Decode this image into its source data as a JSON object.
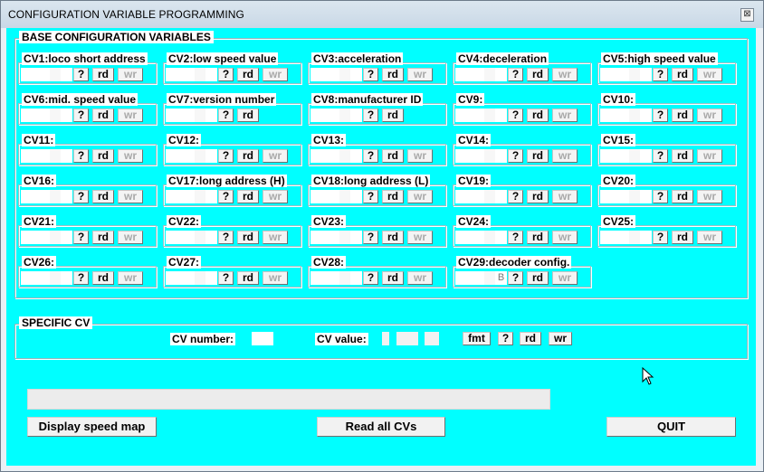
{
  "window": {
    "title": "CONFIGURATION VARIABLE PROGRAMMING",
    "close_glyph": "⊠"
  },
  "base": {
    "label": "BASE CONFIGURATION VARIABLES",
    "cvs": [
      {
        "label": "CV1:loco short address",
        "q": "?",
        "rd": "rd",
        "wr": "wr"
      },
      {
        "label": "CV2:low speed value",
        "q": "?",
        "rd": "rd",
        "wr": "wr"
      },
      {
        "label": "CV3:acceleration",
        "q": "?",
        "rd": "rd",
        "wr": "wr"
      },
      {
        "label": "CV4:deceleration",
        "q": "?",
        "rd": "rd",
        "wr": "wr"
      },
      {
        "label": "CV5:high speed value",
        "q": "?",
        "rd": "rd",
        "wr": "wr"
      },
      {
        "label": "CV6:mid. speed value",
        "q": "?",
        "rd": "rd",
        "wr": "wr"
      },
      {
        "label": "CV7:version number",
        "q": "?",
        "rd": "rd",
        "wr": ""
      },
      {
        "label": "CV8:manufacturer ID",
        "q": "?",
        "rd": "rd",
        "wr": ""
      },
      {
        "label": "CV9:",
        "q": "?",
        "rd": "rd",
        "wr": "wr"
      },
      {
        "label": "CV10:",
        "q": "?",
        "rd": "rd",
        "wr": "wr"
      },
      {
        "label": "CV11:",
        "q": "?",
        "rd": "rd",
        "wr": "wr"
      },
      {
        "label": "CV12:",
        "q": "?",
        "rd": "rd",
        "wr": "wr"
      },
      {
        "label": "CV13:",
        "q": "?",
        "rd": "rd",
        "wr": "wr"
      },
      {
        "label": "CV14:",
        "q": "?",
        "rd": "rd",
        "wr": "wr"
      },
      {
        "label": "CV15:",
        "q": "?",
        "rd": "rd",
        "wr": "wr"
      },
      {
        "label": "CV16:",
        "q": "?",
        "rd": "rd",
        "wr": "wr"
      },
      {
        "label": "CV17:long address (H)",
        "q": "?",
        "rd": "rd",
        "wr": "wr"
      },
      {
        "label": "CV18:long address (L)",
        "q": "?",
        "rd": "rd",
        "wr": "wr"
      },
      {
        "label": "CV19:",
        "q": "?",
        "rd": "rd",
        "wr": "wr"
      },
      {
        "label": "CV20:",
        "q": "?",
        "rd": "rd",
        "wr": "wr"
      },
      {
        "label": "CV21:",
        "q": "?",
        "rd": "rd",
        "wr": "wr"
      },
      {
        "label": "CV22:",
        "q": "?",
        "rd": "rd",
        "wr": "wr"
      },
      {
        "label": "CV23:",
        "q": "?",
        "rd": "rd",
        "wr": "wr"
      },
      {
        "label": "CV24:",
        "q": "?",
        "rd": "rd",
        "wr": "wr"
      },
      {
        "label": "CV25:",
        "q": "?",
        "rd": "rd",
        "wr": "wr"
      },
      {
        "label": "CV26:",
        "q": "?",
        "rd": "rd",
        "wr": "wr"
      },
      {
        "label": "CV27:",
        "q": "?",
        "rd": "rd",
        "wr": "wr"
      },
      {
        "label": "CV28:",
        "q": "?",
        "rd": "rd",
        "wr": "wr"
      },
      {
        "label": "CV29:decoder config.",
        "q": "?",
        "rd": "rd",
        "wr": "wr",
        "extra": "B"
      }
    ]
  },
  "specific": {
    "label": "SPECIFIC CV",
    "cv_number_label": "CV number:",
    "cv_value_label": "CV value:",
    "fmt": "fmt",
    "q": "?",
    "rd": "rd",
    "wr": "wr"
  },
  "buttons": {
    "speed_map": "Display speed map",
    "read_all": "Read all CVs",
    "quit": "QUIT"
  },
  "colors": {
    "client_bg": "#00ffff",
    "disabled_text": "#a9a9a9"
  }
}
